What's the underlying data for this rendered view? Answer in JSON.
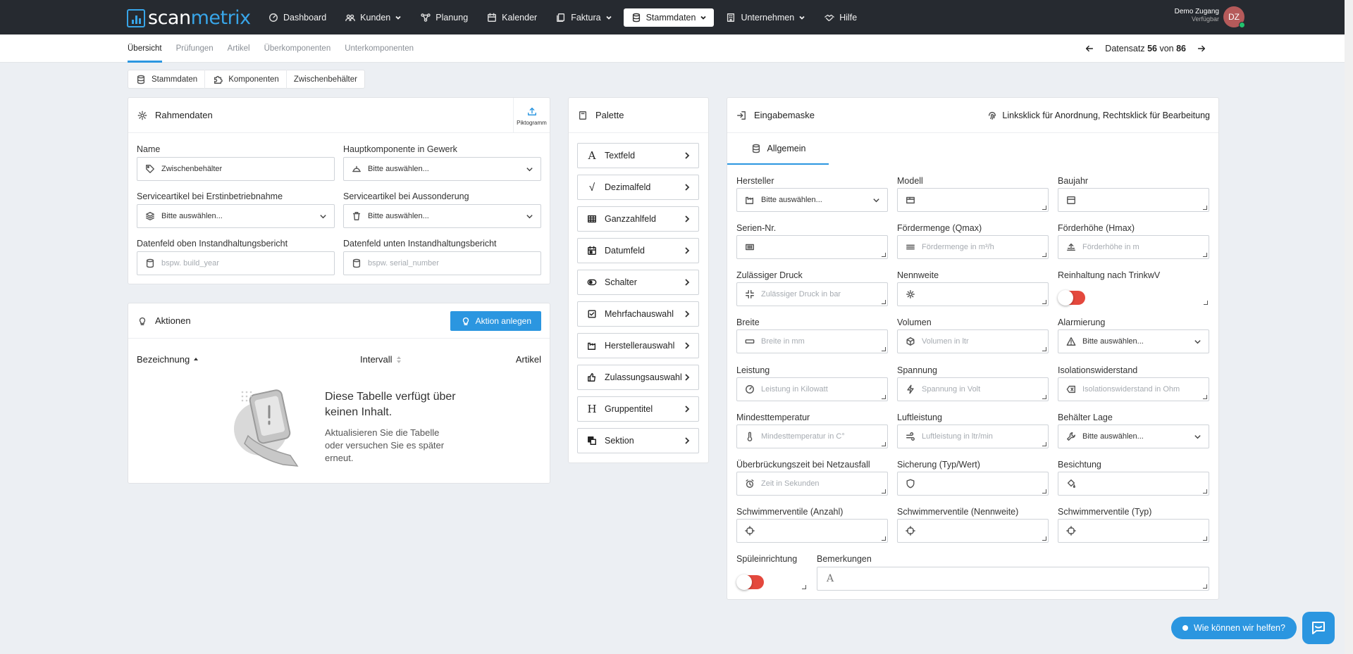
{
  "app": {
    "logo_part1": "scan",
    "logo_part2": "metrix"
  },
  "nav": [
    {
      "label": "Dashboard",
      "icon": "gauge-icon"
    },
    {
      "label": "Kunden",
      "icon": "users-icon",
      "dropdown": true
    },
    {
      "label": "Planung",
      "icon": "network-icon"
    },
    {
      "label": "Kalender",
      "icon": "calendar-icon"
    },
    {
      "label": "Faktura",
      "icon": "receipt-icon",
      "dropdown": true
    },
    {
      "label": "Stammdaten",
      "icon": "database-icon",
      "dropdown": true,
      "active": true
    },
    {
      "label": "Unternehmen",
      "icon": "building-icon",
      "dropdown": true
    },
    {
      "label": "Hilfe",
      "icon": "handshake-icon"
    }
  ],
  "user": {
    "name": "Demo Zugang",
    "status": "Verfügbar",
    "initials": "DZ"
  },
  "subtabs": [
    "Übersicht",
    "Prüfungen",
    "Artikel",
    "Überkomponenten",
    "Unterkomponenten"
  ],
  "record": {
    "prefix": "Datensatz",
    "current": "56",
    "sep": "von",
    "total": "86"
  },
  "breadcrumbs": [
    "Stammdaten",
    "Komponenten",
    "Zwischenbehälter"
  ],
  "rahmendaten": {
    "title": "Rahmendaten",
    "pictogram": "Piktogramm",
    "fields": [
      {
        "label": "Name",
        "value": "Zwischenbehälter",
        "placeholder": ""
      },
      {
        "label": "Hauptkomponente in Gewerk",
        "value": "Bitte auswählen...",
        "placeholder": ""
      },
      {
        "label": "Serviceartikel bei Erstinbetriebnahme",
        "value": "Bitte auswählen...",
        "placeholder": ""
      },
      {
        "label": "Serviceartikel bei Aussonderung",
        "value": "Bitte auswählen...",
        "placeholder": ""
      },
      {
        "label": "Datenfeld oben Instandhaltungsbericht",
        "value": "",
        "placeholder": "bspw. build_year"
      },
      {
        "label": "Datenfeld unten Instandhaltungsbericht",
        "value": "",
        "placeholder": "bspw. serial_number"
      }
    ]
  },
  "aktionen": {
    "title": "Aktionen",
    "add_button": "Aktion anlegen",
    "columns": [
      "Bezeichnung",
      "Intervall",
      "Artikel"
    ],
    "empty_title": "Diese Tabelle verfügt über keinen Inhalt.",
    "empty_sub": "Aktualisieren Sie die Tabelle oder versuchen Sie es später erneut."
  },
  "palette": {
    "title": "Palette",
    "items": [
      "Textfeld",
      "Dezimalfeld",
      "Ganzzahlfeld",
      "Datumfeld",
      "Schalter",
      "Mehrfachauswahl",
      "Herstellerauswahl",
      "Zulassungsauswahl",
      "Gruppentitel",
      "Sektion"
    ]
  },
  "maske": {
    "title": "Eingabemaske",
    "hint": "Linksklick für Anordnung, Rechtsklick für Bearbeitung",
    "tab": "Allgemein",
    "fields": [
      {
        "label": "Hersteller",
        "placeholder": "",
        "value": "Bitte auswählen..."
      },
      {
        "label": "Modell",
        "placeholder": "",
        "value": ""
      },
      {
        "label": "Baujahr",
        "placeholder": "",
        "value": ""
      },
      {
        "label": "Serien-Nr.",
        "placeholder": "",
        "value": ""
      },
      {
        "label": "Fördermenge (Qmax)",
        "placeholder": "Fördermenge in m³/h",
        "value": ""
      },
      {
        "label": "Förderhöhe (Hmax)",
        "placeholder": "Förderhöhe in m",
        "value": ""
      },
      {
        "label": "Zulässiger Druck",
        "placeholder": "Zulässiger Druck in bar",
        "value": ""
      },
      {
        "label": "Nennweite",
        "placeholder": "",
        "value": ""
      },
      {
        "label": "Reinhaltung nach TrinkwV",
        "placeholder": "",
        "value": ""
      },
      {
        "label": "Breite",
        "placeholder": "Breite in mm",
        "value": ""
      },
      {
        "label": "Volumen",
        "placeholder": "Volumen in ltr",
        "value": ""
      },
      {
        "label": "Alarmierung",
        "placeholder": "",
        "value": "Bitte auswählen..."
      },
      {
        "label": "Leistung",
        "placeholder": "Leistung in Kilowatt",
        "value": ""
      },
      {
        "label": "Spannung",
        "placeholder": "Spannung in Volt",
        "value": ""
      },
      {
        "label": "Isolationswiderstand",
        "placeholder": "Isolationswiderstand in Ohm",
        "value": ""
      },
      {
        "label": "Mindesttemperatur",
        "placeholder": "Mindesttemperatur in C°",
        "value": ""
      },
      {
        "label": "Luftleistung",
        "placeholder": "Luftleistung in ltr/min",
        "value": ""
      },
      {
        "label": "Behälter Lage",
        "placeholder": "",
        "value": "Bitte auswählen..."
      },
      {
        "label": "Überbrückungszeit bei Netzausfall",
        "placeholder": "Zeit in Sekunden",
        "value": ""
      },
      {
        "label": "Sicherung (Typ/Wert)",
        "placeholder": "",
        "value": ""
      },
      {
        "label": "Besichtung",
        "placeholder": "",
        "value": ""
      },
      {
        "label": "Schwimmerventile (Anzahl)",
        "placeholder": "",
        "value": ""
      },
      {
        "label": "Schwimmerventile (Nennweite)",
        "placeholder": "",
        "value": ""
      },
      {
        "label": "Schwimmerventile (Typ)",
        "placeholder": "",
        "value": ""
      },
      {
        "label": "Spüleinrichtung",
        "placeholder": "",
        "value": ""
      },
      {
        "label": "Bemerkungen",
        "placeholder": "",
        "value": ""
      }
    ]
  },
  "help": {
    "label": "Wie können wir helfen?"
  },
  "colors": {
    "accent": "#2b96e0",
    "topbar": "#262a30",
    "toggle_off": "#e4483d"
  }
}
